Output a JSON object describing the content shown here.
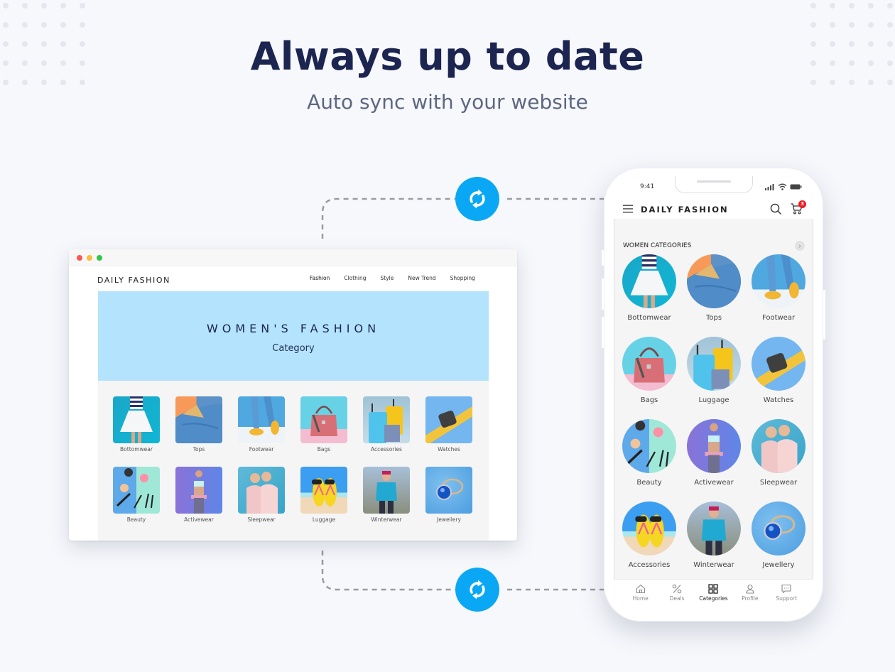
{
  "hero": {
    "title": "Always up to date",
    "subtitle": "Auto sync with your website"
  },
  "colors": {
    "accent": "#0aa8f4",
    "title": "#1b2550",
    "banner_bg": "#b4e3fd",
    "badge": "#ed1c24"
  },
  "sync_icon": "sync-icon",
  "website": {
    "logo": "DAILY  FASHION",
    "nav": [
      "Fashion",
      "Clothing",
      "Style",
      "New Trend",
      "Shopping"
    ],
    "banner_title": "WOMEN'S FASHION",
    "banner_subtitle": "Category",
    "categories": [
      {
        "label": "Bottomwear",
        "image": "skirt"
      },
      {
        "label": "Tops",
        "image": "shirt"
      },
      {
        "label": "Footwear",
        "image": "sandals"
      },
      {
        "label": "Bags",
        "image": "handbag"
      },
      {
        "label": "Accessories",
        "image": "suitcases"
      },
      {
        "label": "Watches",
        "image": "smartwatch"
      },
      {
        "label": "Beauty",
        "image": "makeup"
      },
      {
        "label": "Activewear",
        "image": "fitness"
      },
      {
        "label": "Sleepwear",
        "image": "pajamas"
      },
      {
        "label": "Luggage",
        "image": "beach-flipflops"
      },
      {
        "label": "Winterwear",
        "image": "puffer-jacket"
      },
      {
        "label": "Jewellery",
        "image": "ring"
      }
    ]
  },
  "app": {
    "status_time": "9:41",
    "title": "DAILY  FASHION",
    "cart_count": "3",
    "section_title": "WOMEN CATEGORIES",
    "section_more": "›",
    "categories": [
      {
        "label": "Bottomwear",
        "image": "skirt"
      },
      {
        "label": "Tops",
        "image": "shirt"
      },
      {
        "label": "Footwear",
        "image": "sandals"
      },
      {
        "label": "Bags",
        "image": "handbag"
      },
      {
        "label": "Luggage",
        "image": "suitcases"
      },
      {
        "label": "Watches",
        "image": "smartwatch"
      },
      {
        "label": "Beauty",
        "image": "makeup"
      },
      {
        "label": "Activewear",
        "image": "fitness"
      },
      {
        "label": "Sleepwear",
        "image": "pajamas"
      },
      {
        "label": "Accessories",
        "image": "beach-flipflops"
      },
      {
        "label": "Winterwear",
        "image": "puffer-jacket"
      },
      {
        "label": "Jewellery",
        "image": "ring"
      }
    ],
    "tabs": [
      {
        "label": "Home",
        "icon": "home-icon",
        "active": false
      },
      {
        "label": "Deals",
        "icon": "percent-icon",
        "active": false
      },
      {
        "label": "Categories",
        "icon": "grid-icon",
        "active": true
      },
      {
        "label": "Profile",
        "icon": "user-icon",
        "active": false
      },
      {
        "label": "Support",
        "icon": "chat-icon",
        "active": false
      }
    ]
  }
}
